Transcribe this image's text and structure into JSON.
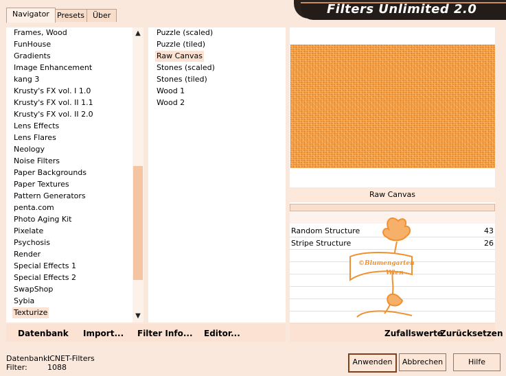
{
  "app_title": "Filters Unlimited 2.0",
  "tabs": [
    "Navigator",
    "Presets",
    "Über"
  ],
  "categories": [
    "Frames, Wood",
    "FunHouse",
    "Gradients",
    "Image Enhancement",
    "kang 3",
    "Krusty's FX vol. I 1.0",
    "Krusty's FX vol. II 1.1",
    "Krusty's FX vol. II 2.0",
    "Lens Effects",
    "Lens Flares",
    "Neology",
    "Noise Filters",
    "Paper Backgrounds",
    "Paper Textures",
    "Pattern Generators",
    "penta.com",
    "Photo Aging Kit",
    "Pixelate",
    "Psychosis",
    "Render",
    "Special Effects 1",
    "Special Effects 2",
    "SwapShop",
    "Sybia",
    "Texturize"
  ],
  "selected_category": "Texturize",
  "filters": [
    "Puzzle (scaled)",
    "Puzzle (tiled)",
    "Raw Canvas",
    "Stones (scaled)",
    "Stones (tiled)",
    "Wood 1",
    "Wood 2"
  ],
  "selected_filter": "Raw Canvas",
  "preview_filter_name": "Raw Canvas",
  "params": [
    {
      "name": "Random Structure",
      "value": "43"
    },
    {
      "name": "Stripe Structure",
      "value": "26"
    }
  ],
  "watermark": {
    "line1": "©Blumengarten",
    "line2": "Wien"
  },
  "toolbar": {
    "datenbank": "Datenbank",
    "import": "Import...",
    "filter_info": "Filter Info...",
    "editor": "Editor...",
    "zufallswerte": "Zufallswerte",
    "zuruecksetzen": "Zurücksetzen"
  },
  "status": {
    "datenbank_label": "Datenbank:",
    "datenbank_value": "ICNET-Filters",
    "filter_label": "Filter:",
    "filter_value": "1088"
  },
  "buttons": {
    "apply": "Anwenden",
    "cancel": "Abbrechen",
    "help": "Hilfe"
  },
  "colors": {
    "background": "#fbe8dc",
    "accent": "#f39a3e",
    "banner": "#231c18"
  }
}
